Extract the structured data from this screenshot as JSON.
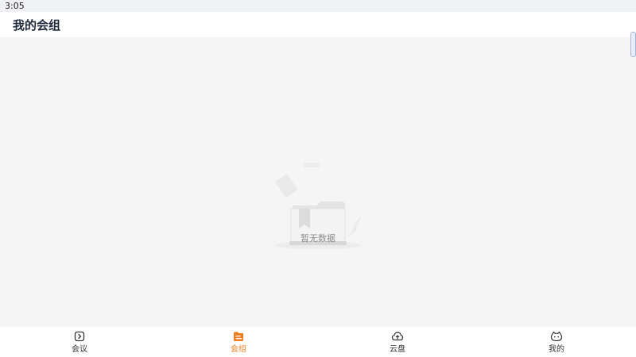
{
  "status_bar": {
    "time": "3:05"
  },
  "header": {
    "title": "我的会组"
  },
  "empty_state": {
    "text": "暂无数据",
    "icon": "empty-box-illustration"
  },
  "tabs": [
    {
      "label": "会议",
      "icon": "meeting-icon",
      "active": false
    },
    {
      "label": "会组",
      "icon": "group-icon",
      "active": true
    },
    {
      "label": "云盘",
      "icon": "cloud-upload-icon",
      "active": false
    },
    {
      "label": "我的",
      "icon": "profile-icon",
      "active": false
    }
  ],
  "colors": {
    "accent": "#f07d1e",
    "background": "#f5f5f5",
    "header_text": "#1f2a3a"
  }
}
